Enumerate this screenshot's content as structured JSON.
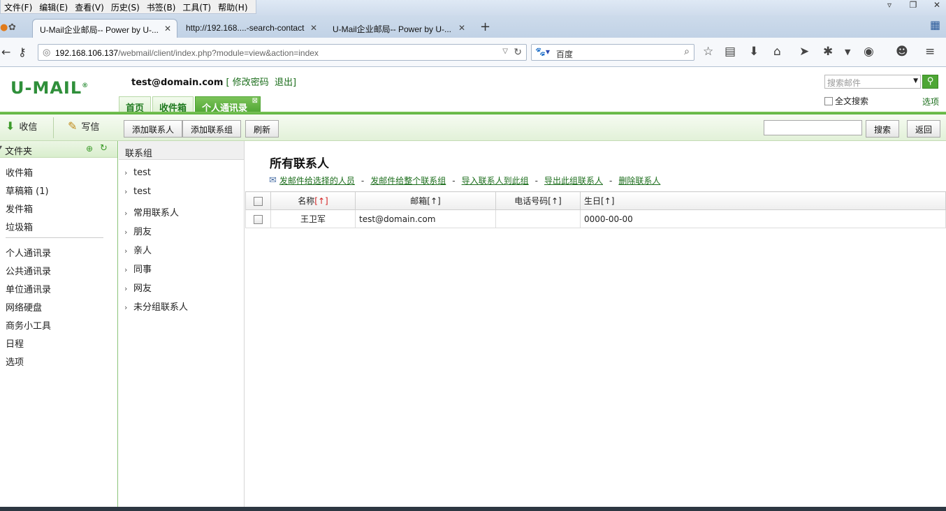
{
  "browser": {
    "menu": [
      "文件(F)",
      "编辑(E)",
      "查看(V)",
      "历史(S)",
      "书签(B)",
      "工具(T)",
      "帮助(H)"
    ],
    "tabs": [
      {
        "label": "U-Mail企业邮局-- Power by U-..."
      },
      {
        "label": "http://192.168....-search-contact"
      },
      {
        "label": "U-Mail企业邮局-- Power by U-..."
      }
    ],
    "url_host": "192.168.106.137",
    "url_path": "/webmail/client/index.php?module=view&action=index",
    "search_engine_text": "百度"
  },
  "header": {
    "logo": "U-MAIL",
    "logo_mark": "®",
    "email": "test@domain.com",
    "bracket_open": "[",
    "bracket_close": "]",
    "change_password": "修改密码",
    "logout": "退出",
    "search_placeholder": "搜索邮件",
    "fulltext_label": "全文搜索",
    "options_link": "选项",
    "tabs": [
      {
        "label": "首页"
      },
      {
        "label": "收件箱"
      },
      {
        "label": "个人通讯录"
      }
    ]
  },
  "toolbar": {
    "receive": "收信",
    "write": "写信",
    "add_contact": "添加联系人",
    "add_group": "添加联系组",
    "refresh": "刷新",
    "search": "搜索",
    "back": "返回"
  },
  "sidebar": {
    "folder_header": "文件夹",
    "folders": [
      "收件箱",
      "草稿箱 (1)",
      "发件箱",
      "垃圾箱"
    ],
    "tools": [
      "个人通讯录",
      "公共通讯录",
      "单位通讯录",
      "网络硬盘",
      "商务小工具",
      "日程",
      "选项"
    ]
  },
  "groups": {
    "header": "联系组",
    "items": [
      "test",
      "test",
      "常用联系人",
      "朋友",
      "亲人",
      "同事",
      "网友",
      "未分组联系人"
    ]
  },
  "main": {
    "title": "所有联系人",
    "actions": [
      "发邮件给选择的人员",
      "发邮件给整个联系组",
      "导入联系人到此组",
      "导出此组联系人",
      "删除联系人"
    ],
    "separator": "-",
    "columns": {
      "name": "名称",
      "name_sort": "[↑]",
      "email": "邮箱[↑]",
      "phone": "电话号码[↑]",
      "birthday": "生日[↑]"
    },
    "rows": [
      {
        "name": "王卫军",
        "email": "test@domain.com",
        "phone": "",
        "birthday": "0000-00-00"
      }
    ]
  }
}
